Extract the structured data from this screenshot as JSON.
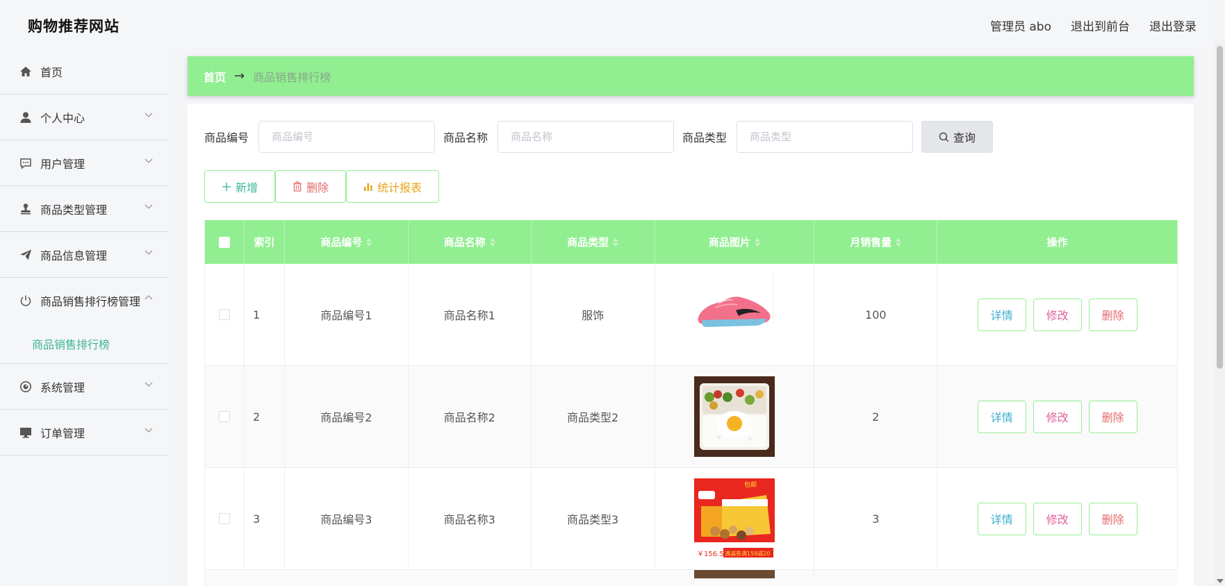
{
  "header": {
    "site_title": "购物推荐网站",
    "admin_label": "管理员 abo",
    "back_front_label": "退出到前台",
    "logout_label": "退出登录"
  },
  "sidebar": {
    "items": [
      {
        "label": "首页",
        "icon": "home-icon"
      },
      {
        "label": "个人中心",
        "icon": "user-icon"
      },
      {
        "label": "用户管理",
        "icon": "chat-icon"
      },
      {
        "label": "商品类型管理",
        "icon": "stamp-icon"
      },
      {
        "label": "商品信息管理",
        "icon": "send-icon"
      },
      {
        "label": "商品销售排行榜管理",
        "icon": "power-icon"
      },
      {
        "label": "系统管理",
        "icon": "gauge-icon"
      },
      {
        "label": "订单管理",
        "icon": "monitor-icon"
      }
    ],
    "active_sub": "商品销售排行榜"
  },
  "breadcrumb": {
    "home": "首页",
    "arrow": "→",
    "current": "商品销售排行榜"
  },
  "search": {
    "code_label": "商品编号",
    "code_placeholder": "商品编号",
    "name_label": "商品名称",
    "name_placeholder": "商品名称",
    "type_label": "商品类型",
    "type_placeholder": "商品类型",
    "query_label": "查询"
  },
  "actions": {
    "add": "新增",
    "delete": "删除",
    "stats": "统计报表"
  },
  "table": {
    "headers": {
      "index": "索引",
      "code": "商品编号",
      "name": "商品名称",
      "type": "商品类型",
      "image": "商品图片",
      "sales": "月销售量",
      "ops": "操作"
    },
    "rows": [
      {
        "index": "1",
        "code": "商品编号1",
        "name": "商品名称1",
        "type": "服饰",
        "sales": "100",
        "image": "pink-sneaker"
      },
      {
        "index": "2",
        "code": "商品编号2",
        "name": "商品名称2",
        "type": "商品类型2",
        "sales": "2",
        "image": "bento-box"
      },
      {
        "index": "3",
        "code": "商品编号3",
        "name": "商品名称3",
        "type": "商品类型3",
        "sales": "3",
        "image": "nut-gift-box"
      }
    ],
    "ops": {
      "detail": "详情",
      "edit": "修改",
      "remove": "删除"
    },
    "image_texts": {
      "mail": "包邮",
      "price": "￥156.5",
      "promo": "满减券满159减20"
    }
  },
  "colors": {
    "accent_green": "#91ee91",
    "teal": "#3bb598",
    "danger": "#e46a6a",
    "warning": "#e8a316",
    "info": "#3baecd",
    "pink": "#e0609a"
  }
}
